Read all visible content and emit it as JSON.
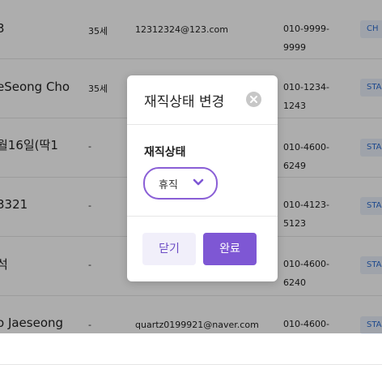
{
  "rows": [
    {
      "name": "3",
      "age": "35세",
      "email": "12312324@123.com",
      "phone": "010-9999-9999",
      "status": "CH"
    },
    {
      "name": "eSeong Cho",
      "age": "35세",
      "email": "",
      "phone": "010-1234-1243",
      "status": "STA"
    },
    {
      "name": "월16일(딱1",
      "name_line2": "",
      "age": "-",
      "email": "",
      "phone": "010-4600-6249",
      "status": "STA"
    },
    {
      "name": "3321",
      "age": "-",
      "email": "",
      "phone": "010-4123-5123",
      "status": "STA"
    },
    {
      "name": "석",
      "age": "-",
      "email": "",
      "phone": "010-4600-6240",
      "status": "STA"
    },
    {
      "name": "o Jaeseong",
      "age": "-",
      "email": "quartz0199921@naver.com",
      "phone": "010-4600-",
      "status": "STA"
    }
  ],
  "modal": {
    "title": "재직상태 변경",
    "field_label": "재직상태",
    "select_value": "휴직",
    "close_button": "닫기",
    "done_button": "완료"
  },
  "colors": {
    "accent": "#7e57d4",
    "status_bg": "#ebf1fb",
    "status_text": "#2e6ed1"
  }
}
